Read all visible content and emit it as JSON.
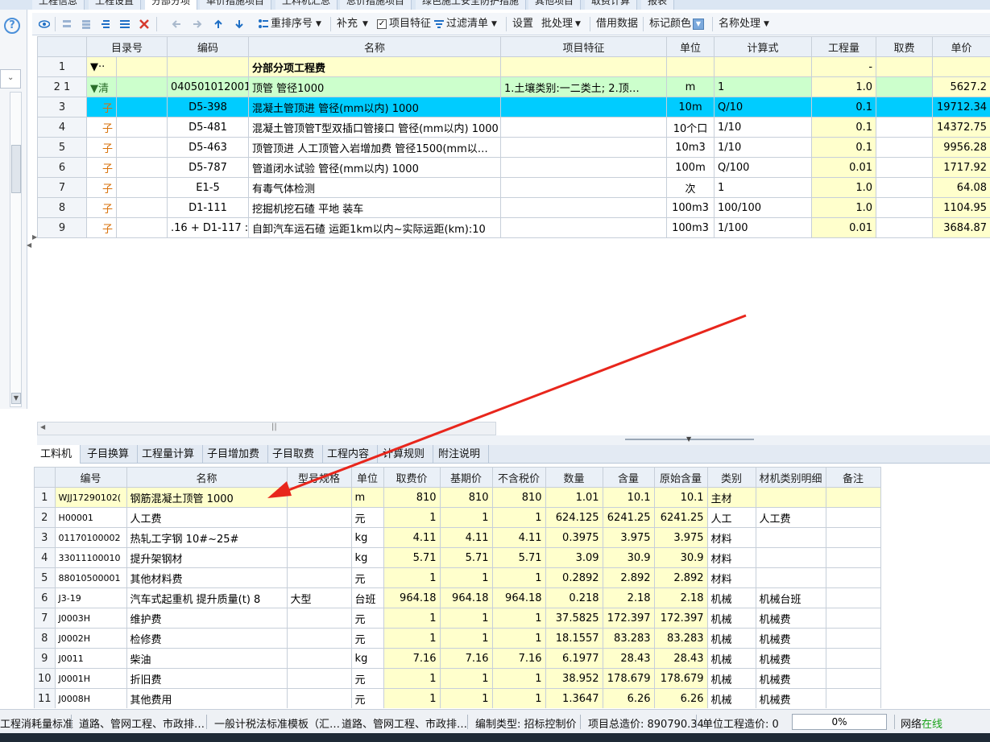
{
  "top_tabs": [
    "工程信息",
    "工程设置",
    "分部分项",
    "单价措施项目",
    "工料机汇总",
    "总价措施项目",
    "绿色施工安全防护措施",
    "其他项目",
    "取费计算",
    "报表"
  ],
  "active_top_tab": "分部分项",
  "toolbar": {
    "reorder_label": "重排序号",
    "supplement_label": "补充",
    "item_feature_label": "项目特征",
    "filter_label": "过滤清单",
    "settings_label": "设置",
    "batch_label": "批处理",
    "borrow_label": "借用数据",
    "mark_color_label": "标记颜色",
    "name_process_label": "名称处理"
  },
  "grid1": {
    "headers": [
      "目录号",
      "编码",
      "名称",
      "项目特征",
      "单位",
      "计算式",
      "工程量",
      "取费",
      "单价"
    ],
    "rows": [
      {
        "rn": "1",
        "tree": "▼··",
        "code": "",
        "name": "分部分项工程费",
        "feature": "",
        "unit": "",
        "formula": "",
        "qty": "-",
        "fee": "",
        "price": ""
      },
      {
        "rn": "2 1",
        "tree": "▼清",
        "code": "040501012001",
        "name": "顶管 管径1000",
        "feature": "1.土壤类别:一二类土;  2.顶…",
        "unit": "m",
        "formula": "1",
        "qty": "1.0",
        "fee": "",
        "price": "5627.2"
      },
      {
        "rn": "3",
        "tree": "子",
        "code": "D5-398",
        "name": "混凝土管顶进 管径(mm以内) 1000",
        "feature": "",
        "unit": "10m",
        "formula": "Q/10",
        "qty": "0.1",
        "fee": "",
        "price": "19712.34"
      },
      {
        "rn": "4",
        "tree": "子",
        "code": "D5-481",
        "name": "混凝土管顶管T型双插口管接口 管径(mm以内) 1000",
        "feature": "",
        "unit": "10个口",
        "formula": "1/10",
        "qty": "0.1",
        "fee": "",
        "price": "14372.75"
      },
      {
        "rn": "5",
        "tree": "子",
        "code": "D5-463",
        "name": "顶管顶进 人工顶管入岩增加费 管径1500(mm以…",
        "feature": "",
        "unit": "10m3",
        "formula": "1/10",
        "qty": "0.1",
        "fee": "",
        "price": "9956.28"
      },
      {
        "rn": "6",
        "tree": "子",
        "code": "D5-787",
        "name": "管道闭水试验 管径(mm以内) 1000",
        "feature": "",
        "unit": "100m",
        "formula": "Q/100",
        "qty": "0.01",
        "fee": "",
        "price": "1717.92"
      },
      {
        "rn": "7",
        "tree": "子",
        "code": "E1-5",
        "name": "有毒气体检测",
        "feature": "",
        "unit": "次",
        "formula": "1",
        "qty": "1.0",
        "fee": "",
        "price": "64.08"
      },
      {
        "rn": "8",
        "tree": "子",
        "code": "D1-111",
        "name": "挖掘机挖石碴 平地 装车",
        "feature": "",
        "unit": "100m3",
        "formula": "100/100",
        "qty": "1.0",
        "fee": "",
        "price": "1104.95"
      },
      {
        "rn": "9",
        "tree": "子",
        "code": ".16 + D1-117 :",
        "name": "自卸汽车运石碴 运距1km以内~实际运距(km):10",
        "feature": "",
        "unit": "100m3",
        "formula": "1/100",
        "qty": "0.01",
        "fee": "",
        "price": "3684.87"
      }
    ]
  },
  "lower_tabs": [
    "工料机",
    "子目换算",
    "工程量计算",
    "子目增加费",
    "子目取费",
    "工程内容",
    "计算规则",
    "附注说明"
  ],
  "active_lower_tab": "工料机",
  "grid2": {
    "headers": [
      "编号",
      "名称",
      "型号规格",
      "单位",
      "取费价",
      "基期价",
      "不含税价",
      "数量",
      "含量",
      "原始含量",
      "类别",
      "材机类别明细",
      "备注"
    ],
    "rows": [
      {
        "rn": "1",
        "code": "WJJ17290102(",
        "name": "钢筋混凝土顶管 1000",
        "spec": "",
        "unit": "m",
        "fee": "810",
        "base": "810",
        "notax": "810",
        "qty": "1.01",
        "content": "10.1",
        "orig": "10.1",
        "cat": "主材",
        "detail": "",
        "note": ""
      },
      {
        "rn": "2",
        "code": "H00001",
        "name": "人工费",
        "spec": "",
        "unit": "元",
        "fee": "1",
        "base": "1",
        "notax": "1",
        "qty": "624.125",
        "content": "6241.25",
        "orig": "6241.25",
        "cat": "人工",
        "detail": "人工费",
        "note": ""
      },
      {
        "rn": "3",
        "code": "01170100002",
        "name": "热轧工字钢 10#~25#",
        "spec": "",
        "unit": "kg",
        "fee": "4.11",
        "base": "4.11",
        "notax": "4.11",
        "qty": "0.3975",
        "content": "3.975",
        "orig": "3.975",
        "cat": "材料",
        "detail": "",
        "note": ""
      },
      {
        "rn": "4",
        "code": "33011100010",
        "name": "提升架钢材",
        "spec": "",
        "unit": "kg",
        "fee": "5.71",
        "base": "5.71",
        "notax": "5.71",
        "qty": "3.09",
        "content": "30.9",
        "orig": "30.9",
        "cat": "材料",
        "detail": "",
        "note": ""
      },
      {
        "rn": "5",
        "code": "88010500001",
        "name": "其他材料费",
        "spec": "",
        "unit": "元",
        "fee": "1",
        "base": "1",
        "notax": "1",
        "qty": "0.2892",
        "content": "2.892",
        "orig": "2.892",
        "cat": "材料",
        "detail": "",
        "note": ""
      },
      {
        "rn": "6",
        "code": "J3-19",
        "name": "汽车式起重机 提升质量(t) 8",
        "spec": "大型",
        "unit": "台班",
        "fee": "964.18",
        "base": "964.18",
        "notax": "964.18",
        "qty": "0.218",
        "content": "2.18",
        "orig": "2.18",
        "cat": "机械",
        "detail": "机械台班",
        "note": ""
      },
      {
        "rn": "7",
        "code": "J0003H",
        "name": "维护费",
        "spec": "",
        "unit": "元",
        "fee": "1",
        "base": "1",
        "notax": "1",
        "qty": "37.5825",
        "content": "172.397",
        "orig": "172.397",
        "cat": "机械",
        "detail": "机械费",
        "note": ""
      },
      {
        "rn": "8",
        "code": "J0002H",
        "name": "检修费",
        "spec": "",
        "unit": "元",
        "fee": "1",
        "base": "1",
        "notax": "1",
        "qty": "18.1557",
        "content": "83.283",
        "orig": "83.283",
        "cat": "机械",
        "detail": "机械费",
        "note": ""
      },
      {
        "rn": "9",
        "code": "J0011",
        "name": "柴油",
        "spec": "",
        "unit": "kg",
        "fee": "7.16",
        "base": "7.16",
        "notax": "7.16",
        "qty": "6.1977",
        "content": "28.43",
        "orig": "28.43",
        "cat": "机械",
        "detail": "机械费",
        "note": ""
      },
      {
        "rn": "10",
        "code": "J0001H",
        "name": "折旧费",
        "spec": "",
        "unit": "元",
        "fee": "1",
        "base": "1",
        "notax": "1",
        "qty": "38.952",
        "content": "178.679",
        "orig": "178.679",
        "cat": "机械",
        "detail": "机械费",
        "note": ""
      },
      {
        "rn": "11",
        "code": "J0008H",
        "name": "其他费用",
        "spec": "",
        "unit": "元",
        "fee": "1",
        "base": "1",
        "notax": "1",
        "qty": "1.3647",
        "content": "6.26",
        "orig": "6.26",
        "cat": "机械",
        "detail": "机械费",
        "note": ""
      }
    ]
  },
  "status": {
    "s1": "工程消耗量标准",
    "s2": "道路、管网工程、市政排…",
    "s3": "一般计税法标准模板（汇…",
    "s4": "道路、管网工程、市政排…",
    "s5": "编制类型: 招标控制价",
    "s6": "项目总造价: 890790.34",
    "s7": "单位工程造价: 0",
    "progress": "0%",
    "network_label": "网络",
    "network_state": "在线"
  },
  "colors": {
    "selected_row": "#00ccff",
    "yellow_cell": "#ffffcc",
    "green_row": "#ccffcc",
    "arrow": "#e8261c",
    "online": "#1aa31a"
  }
}
